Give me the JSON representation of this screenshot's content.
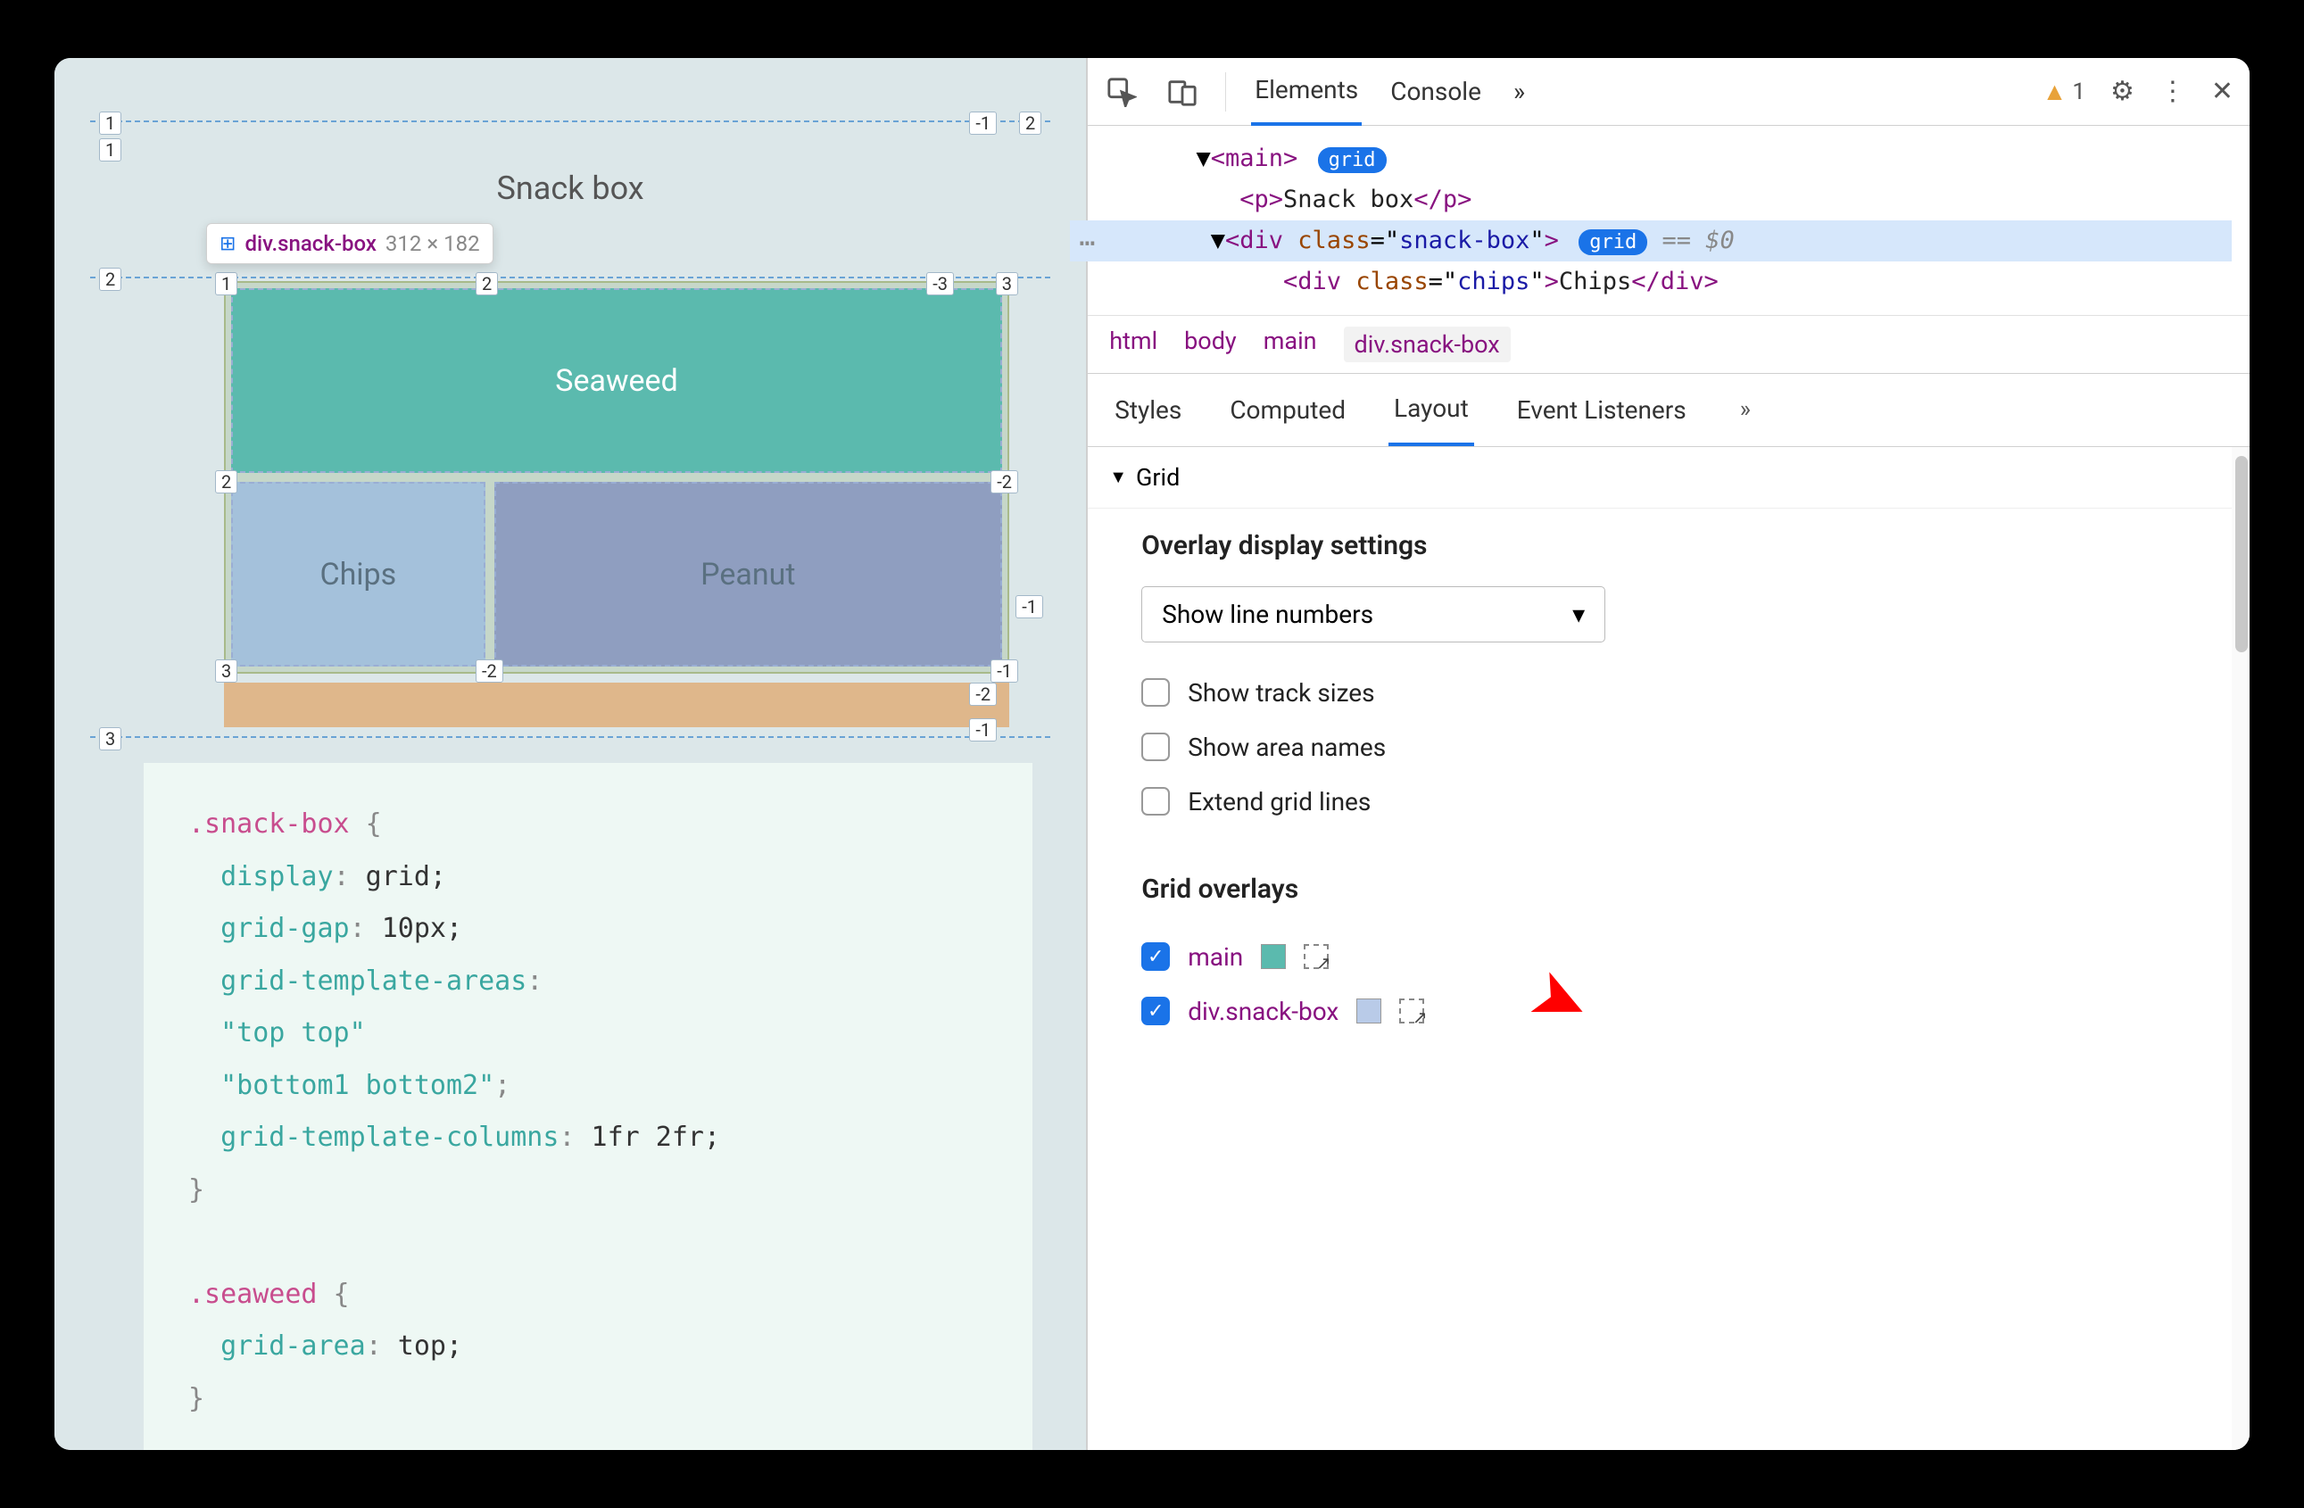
{
  "viewport": {
    "title": "Snack box",
    "tooltip": {
      "selector": "div.snack-box",
      "dimensions": "312 × 182"
    },
    "cells": {
      "seaweed": "Seaweed",
      "chips": "Chips",
      "peanut": "Peanut"
    },
    "line_numbers": {
      "outer_tl": "1",
      "outer_tr_neg": "-1",
      "outer_tr": "2",
      "row2_l": "2",
      "row2_r_neg": "-2",
      "row3_l": "3",
      "row3_r_neg": "-1",
      "inner_top_l1": "1",
      "inner_top_c2": "2",
      "inner_top_r_neg3": "-3",
      "inner_top_r3": "3",
      "inner_mid_l2": "2",
      "inner_mid_r_neg2": "-2",
      "inner_bot_l3": "3",
      "inner_bot_c_neg2": "-2",
      "inner_bot_r_neg1": "-1",
      "inner_bot_side_neg1": "-1"
    }
  },
  "code": {
    "l1_sel": ".snack-box",
    "l1_brace": " {",
    "l2_prop": "display",
    "l2_val": " grid;",
    "l3_prop": "grid-gap",
    "l3_val": " 10px;",
    "l4_prop": "grid-template-areas",
    "l4_colon": ":",
    "l5_str": "\"top top\"",
    "l6_str": "\"bottom1 bottom2\"",
    "l6_semi": ";",
    "l7_prop": "grid-template-columns",
    "l7_val": " 1fr 2fr;",
    "l8_brace": "}",
    "l9_sel": ".seaweed",
    "l9_brace": " {",
    "l10_prop": "grid-area",
    "l10_val": " top;",
    "l11_brace": "}"
  },
  "devtools": {
    "tabs": {
      "elements": "Elements",
      "console": "Console"
    },
    "warning_count": "1",
    "dom": {
      "main_open": "main",
      "grid_badge": "grid",
      "p_text": "Snack box",
      "div_class": "snack-box",
      "eq": " == $0",
      "chips_class": "chips",
      "chips_text": "Chips"
    },
    "breadcrumb": [
      "html",
      "body",
      "main",
      "div.snack-box"
    ],
    "subtabs": {
      "styles": "Styles",
      "computed": "Computed",
      "layout": "Layout",
      "listeners": "Event Listeners"
    },
    "grid_section": "Grid",
    "overlay_settings": {
      "title": "Overlay display settings",
      "dropdown": "Show line numbers",
      "track_sizes": "Show track sizes",
      "area_names": "Show area names",
      "extend_lines": "Extend grid lines"
    },
    "grid_overlays": {
      "title": "Grid overlays",
      "items": [
        {
          "name": "main",
          "swatch": "#5bbaae",
          "checked": true
        },
        {
          "name": "div.snack-box",
          "swatch": "#b9cbe8",
          "checked": true
        }
      ]
    }
  }
}
